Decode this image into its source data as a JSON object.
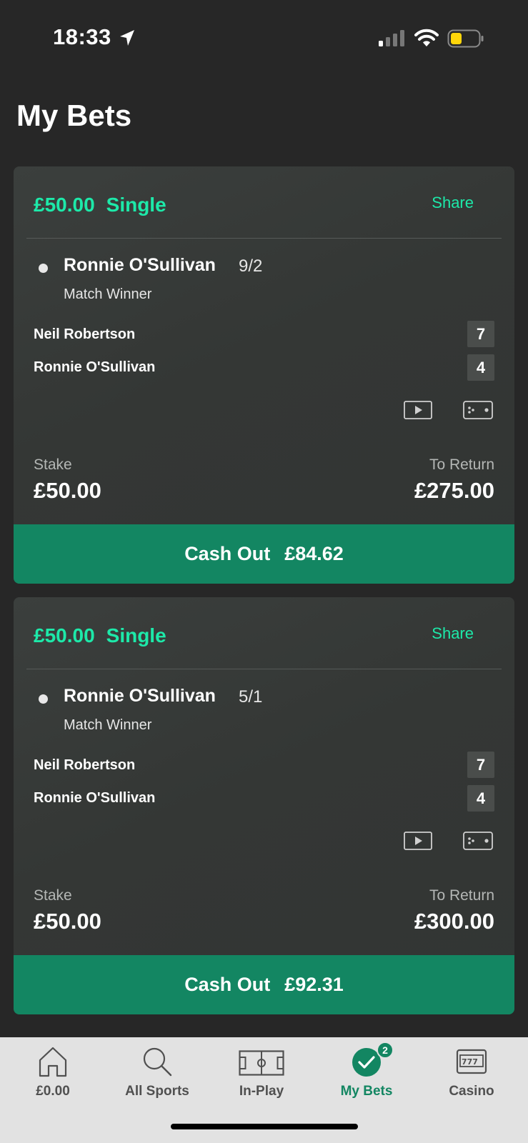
{
  "status_bar": {
    "time": "18:33"
  },
  "page": {
    "title": "My Bets"
  },
  "bets": [
    {
      "stake_header": "£50.00",
      "bet_type": "Single",
      "share_label": "Share",
      "selection": "Ronnie O'Sullivan",
      "odds": "9/2",
      "market": "Match Winner",
      "players": [
        {
          "name": "Neil Robertson",
          "score": "7"
        },
        {
          "name": "Ronnie O'Sullivan",
          "score": "4"
        }
      ],
      "stake_label": "Stake",
      "stake_value": "£50.00",
      "return_label": "To Return",
      "return_value": "£275.00",
      "cashout_label": "Cash Out",
      "cashout_value": "£84.62"
    },
    {
      "stake_header": "£50.00",
      "bet_type": "Single",
      "share_label": "Share",
      "selection": "Ronnie O'Sullivan",
      "odds": "5/1",
      "market": "Match Winner",
      "players": [
        {
          "name": "Neil Robertson",
          "score": "7"
        },
        {
          "name": "Ronnie O'Sullivan",
          "score": "4"
        }
      ],
      "stake_label": "Stake",
      "stake_value": "£50.00",
      "return_label": "To Return",
      "return_value": "£300.00",
      "cashout_label": "Cash Out",
      "cashout_value": "£92.31"
    }
  ],
  "tab_bar": {
    "items": [
      {
        "label": "£0.00",
        "icon": "home-icon"
      },
      {
        "label": "All Sports",
        "icon": "search-icon"
      },
      {
        "label": "In-Play",
        "icon": "pitch-icon"
      },
      {
        "label": "My Bets",
        "icon": "check-icon",
        "badge": "2",
        "active": true
      },
      {
        "label": "Casino",
        "icon": "slot-machine-icon"
      }
    ]
  },
  "colors": {
    "accent": "#1de9a9",
    "cashout": "#138662",
    "background": "#272727",
    "card": "#353836",
    "tab_bar": "#e2e2e2"
  }
}
